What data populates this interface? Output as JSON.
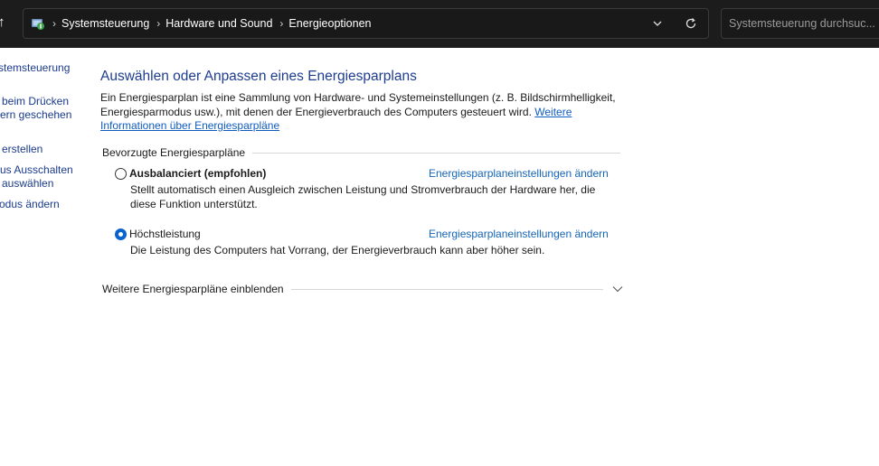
{
  "address_bar": {
    "breadcrumbs": [
      "Systemsteuerung",
      "Hardware und Sound",
      "Energieoptionen"
    ],
    "search_placeholder": "Systemsteuerung durchsuc..."
  },
  "left_pane": {
    "lines": [
      "stemsteuerung",
      "beim Drücken",
      "ern geschehen",
      "erstellen",
      "us Ausschalten",
      "auswählen",
      "odus ändern"
    ]
  },
  "main": {
    "title": "Auswählen oder Anpassen eines Energiesparplans",
    "intro_text": "Ein Energiesparplan ist eine Sammlung von Hardware- und Systemeinstellungen (z. B. Bildschirmhelligkeit, Energiesparmodus usw.), mit denen der Energieverbrauch des Computers gesteuert wird. ",
    "intro_link": "Weitere Informationen über Energiesparpläne",
    "section_label": "Bevorzugte Energiesparpläne",
    "plans": [
      {
        "name": "Ausbalanciert (empfohlen)",
        "selected": false,
        "link": "Energiesparplaneinstellungen ändern",
        "description": "Stellt automatisch einen Ausgleich zwischen Leistung und Stromverbrauch der Hardware her, die diese Funktion unterstützt."
      },
      {
        "name": "Höchstleistung",
        "selected": true,
        "link": "Energiesparplaneinstellungen ändern",
        "description": "Die Leistung des Computers hat Vorrang, der Energieverbrauch kann aber höher sein."
      }
    ],
    "more_plans_label": "Weitere Energiesparpläne einblenden"
  },
  "colors": {
    "title_blue": "#1e3d8f",
    "link_blue": "#1565b8",
    "radio_selected": "#0a63cf",
    "topbar_bg": "#1c1c1c"
  }
}
